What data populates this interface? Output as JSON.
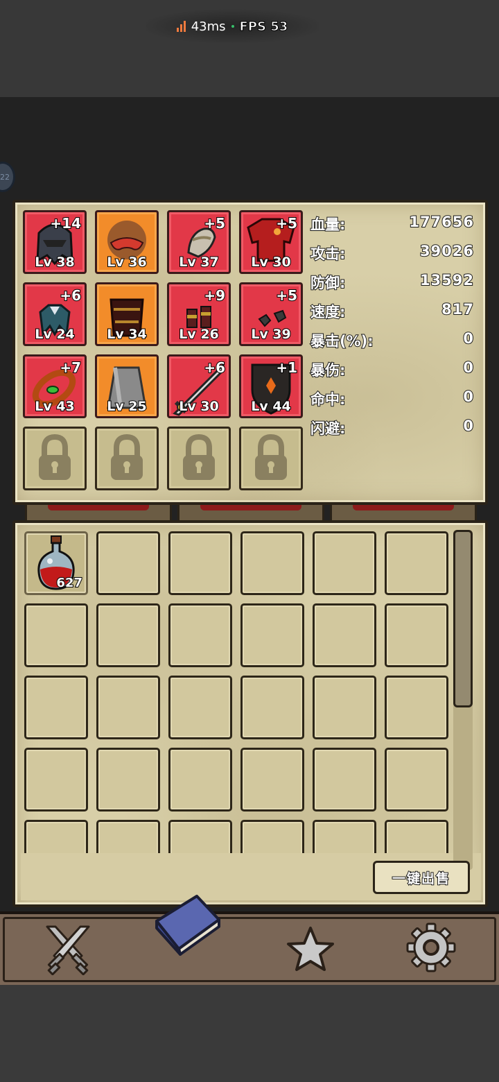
{
  "status_bar": {
    "latency": "43ms",
    "separator": "·",
    "fps": "FPS 53",
    "colors": {
      "signal": "#f07a3e",
      "dot": "#37c06a"
    }
  },
  "side_badge": "22",
  "equipment": [
    {
      "name": "dark helmet",
      "plus": "+14",
      "level": "Lv 38",
      "rarity": "red",
      "icon": "helmet-icon"
    },
    {
      "name": "mask",
      "plus": "",
      "level": "Lv 36",
      "rarity": "orange",
      "icon": "mask-icon"
    },
    {
      "name": "shoulder pad",
      "plus": "+5",
      "level": "Lv 37",
      "rarity": "red",
      "icon": "pauldron-icon"
    },
    {
      "name": "red armor",
      "plus": "+5",
      "level": "Lv 30",
      "rarity": "red",
      "icon": "armor-icon"
    },
    {
      "name": "cape",
      "plus": "+6",
      "level": "Lv 24",
      "rarity": "red",
      "icon": "cape-icon"
    },
    {
      "name": "belt",
      "plus": "",
      "level": "Lv 34",
      "rarity": "orange",
      "icon": "belt-icon"
    },
    {
      "name": "boots",
      "plus": "+9",
      "level": "Lv 26",
      "rarity": "red",
      "icon": "boots-icon"
    },
    {
      "name": "gloves",
      "plus": "+5",
      "level": "Lv 39",
      "rarity": "red",
      "icon": "gloves-icon"
    },
    {
      "name": "bracelet",
      "plus": "+7",
      "level": "Lv 43",
      "rarity": "red",
      "icon": "bracelet-icon"
    },
    {
      "name": "cloak",
      "plus": "",
      "level": "Lv 25",
      "rarity": "orange",
      "icon": "cloak-icon"
    },
    {
      "name": "sword",
      "plus": "+6",
      "level": "Lv 30",
      "rarity": "red",
      "icon": "sword-icon"
    },
    {
      "name": "shield",
      "plus": "+1",
      "level": "Lv 44",
      "rarity": "red",
      "icon": "shield-icon"
    }
  ],
  "locked_slots": 4,
  "stats": [
    {
      "label": "血量:",
      "value": "177656"
    },
    {
      "label": "攻击:",
      "value": "39026"
    },
    {
      "label": "防御:",
      "value": "13592"
    },
    {
      "label": "速度:",
      "value": "817"
    },
    {
      "label": "暴击(%):",
      "value": "0"
    },
    {
      "label": "暴伤:",
      "value": "0"
    },
    {
      "label": "命中:",
      "value": "0"
    },
    {
      "label": "闪避:",
      "value": "0"
    }
  ],
  "inventory": {
    "items": [
      {
        "icon": "potion-icon",
        "quantity": "627"
      }
    ],
    "columns": 6,
    "visible_rows": 5,
    "scroll_fraction": 0.52
  },
  "sell_all_label": "一键出售",
  "nav": [
    {
      "name": "battle",
      "icon": "crossed-swords-icon"
    },
    {
      "name": "inventory",
      "icon": "book-icon",
      "active": true
    },
    {
      "name": "favorites",
      "icon": "star-icon"
    },
    {
      "name": "settings",
      "icon": "gear-icon"
    }
  ],
  "colors": {
    "rarity_red": "#e23848",
    "rarity_orange": "#f28c2a",
    "parchment": "#d8cfa8"
  }
}
